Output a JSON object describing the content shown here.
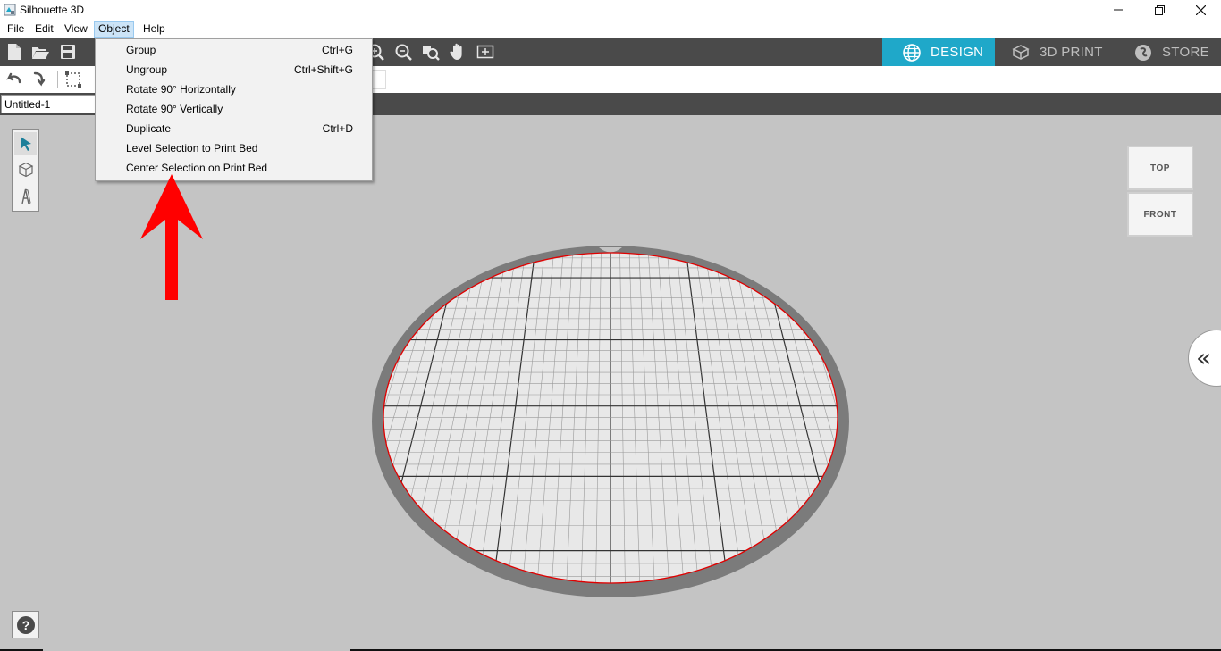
{
  "window": {
    "title": "Silhouette 3D",
    "minimize": "—",
    "restore": "❐",
    "close": "✕"
  },
  "menubar": {
    "items": [
      "File",
      "Edit",
      "View",
      "Object",
      "Help"
    ],
    "active": "Object"
  },
  "object_menu": {
    "items": [
      {
        "label": "Group",
        "shortcut": "Ctrl+G"
      },
      {
        "label": "Ungroup",
        "shortcut": "Ctrl+Shift+G"
      },
      {
        "label": "Rotate 90° Horizontally",
        "shortcut": ""
      },
      {
        "label": "Rotate 90° Vertically",
        "shortcut": ""
      },
      {
        "label": "Duplicate",
        "shortcut": "Ctrl+D"
      },
      {
        "label": "Level Selection to Print Bed",
        "shortcut": ""
      },
      {
        "label": "Center Selection on Print Bed",
        "shortcut": ""
      }
    ]
  },
  "mode_tabs": [
    {
      "label": "DESIGN",
      "icon": "globe-icon",
      "active": true
    },
    {
      "label": "3D PRINT",
      "icon": "cube-print-icon",
      "active": false
    },
    {
      "label": "STORE",
      "icon": "store-icon",
      "active": false
    }
  ],
  "document": {
    "tab_label": "Untitled-1"
  },
  "view_cube": {
    "top": "TOP",
    "front": "FRONT"
  },
  "side_panel": {
    "collapse_glyph": "«"
  },
  "help": {
    "glyph": "?"
  },
  "colors": {
    "accent": "#1fa8c9",
    "toolbar": "#4a4a4a",
    "canvas": "#c4c4c4",
    "annotation_arrow": "#ff0000",
    "bed_edge": "#e00000"
  },
  "icons": {
    "toolbar_main": [
      "new-file-icon",
      "open-folder-icon",
      "save-icon",
      "zoom-in-icon",
      "zoom-out-icon",
      "zoom-fit-icon",
      "pan-hand-icon",
      "fit-page-icon"
    ],
    "toolbar_secondary": [
      "undo-icon",
      "redo-icon",
      "select-box-icon"
    ],
    "palette": [
      "select-arrow-icon",
      "shape-cube-icon",
      "text-icon"
    ]
  }
}
